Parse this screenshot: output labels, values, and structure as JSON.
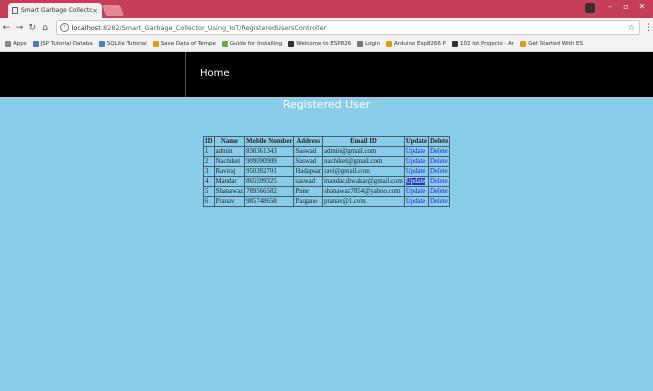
{
  "browser": {
    "tab_title": "Smart Garbage Collecto",
    "tab_close": "×",
    "url_host": "localhost",
    "url_rest": ":8282/Smart_Garbage_Collector_Using_IoT/RegisteredUsersController",
    "bookmarks": [
      {
        "label": "Apps",
        "icon": "apps-grid-icon",
        "color": "#888888"
      },
      {
        "label": "JSP Tutorial Databa",
        "icon": "jsp-icon",
        "color": "#4a7fbf"
      },
      {
        "label": "SQLite Tutorial",
        "icon": "sqlite-icon",
        "color": "#4a7fbf"
      },
      {
        "label": "Save Data of Tempe",
        "icon": "bookmark-icon",
        "color": "#e0a000"
      },
      {
        "label": "Guide for Installing",
        "icon": "bookmark-icon",
        "color": "#6aa84f"
      },
      {
        "label": "Welcome to ESP826",
        "icon": "bookmark-icon",
        "color": "#333333"
      },
      {
        "label": "Login",
        "icon": "page-icon",
        "color": "#777777"
      },
      {
        "label": "Arduino Esp8266 P",
        "icon": "bookmark-icon",
        "color": "#e0a000"
      },
      {
        "label": "102 iot Projects - Ar",
        "icon": "bookmark-icon",
        "color": "#333333"
      },
      {
        "label": "Get Started With ES",
        "icon": "bookmark-icon",
        "color": "#e0a000"
      }
    ]
  },
  "nav": {
    "home": "Home"
  },
  "page": {
    "title": "Registered User"
  },
  "table": {
    "headers": [
      "ID",
      "Name",
      "Mobile Number",
      "Address",
      "Email ID",
      "Update",
      "Delete"
    ],
    "rows": [
      {
        "id": "1",
        "name": "admin",
        "mobile": "830361343",
        "address": "Saswad",
        "email": "admin@gmail.com",
        "update": "Update",
        "delete": "Delete"
      },
      {
        "id": "2",
        "name": "Nachiket",
        "mobile": "909090909",
        "address": "Saswad",
        "email": "nachiket@gmail.com",
        "update": "Update",
        "delete": "Delete"
      },
      {
        "id": "3",
        "name": "Raviraj",
        "mobile": "950392701",
        "address": "Hadapsar",
        "email": "ravi@gmail.com",
        "update": "Update",
        "delete": "Delete"
      },
      {
        "id": "4",
        "name": "Mandar",
        "mobile": "865599325",
        "address": "saswad",
        "email": "mandar.diwakar@gmail.com",
        "update": "Update",
        "delete": "Delete"
      },
      {
        "id": "5",
        "name": "Shanawaz",
        "mobile": "789566582",
        "address": "Pune",
        "email": "shanawaz7854@yahoo.com",
        "update": "Update",
        "delete": "Delete"
      },
      {
        "id": "6",
        "name": "Pranav",
        "mobile": "985748658",
        "address": "Pargane",
        "email": "pranav@1.com",
        "update": "Update",
        "delete": "Delete"
      }
    ]
  },
  "colors": {
    "page_bg": "#87cdea",
    "nav_bg": "#000000",
    "titlebar": "#c43e57",
    "link": "#1a1aff"
  }
}
